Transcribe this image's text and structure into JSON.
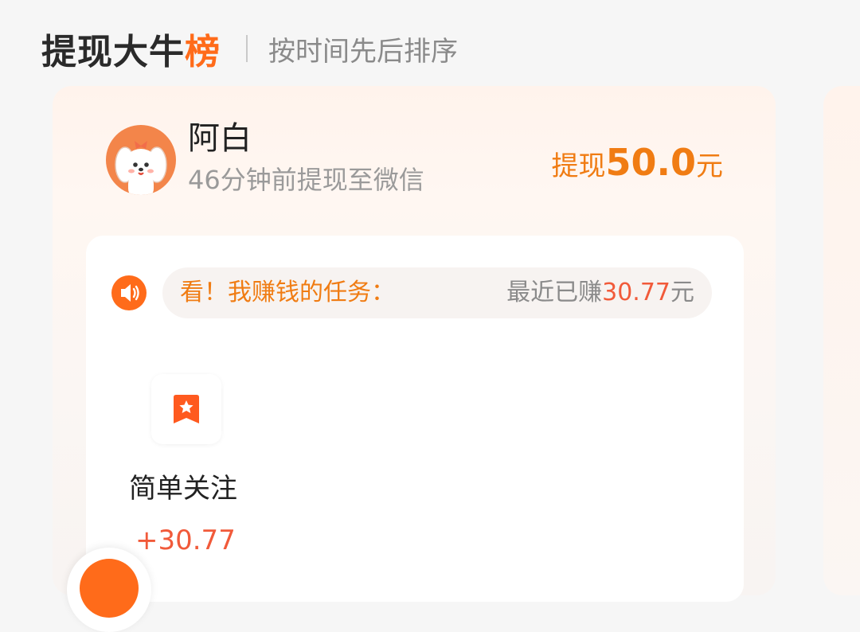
{
  "header": {
    "title_main": "提现大牛",
    "title_accent": "榜",
    "subtitle": "按时间先后排序"
  },
  "record": {
    "user_name": "阿白",
    "meta": "46分钟前提现至微信",
    "withdraw_label": "提现",
    "withdraw_amount": "50.0",
    "withdraw_unit": "元"
  },
  "notice": {
    "label": "看！我赚钱的任务：",
    "recent_prefix": "最近已赚",
    "recent_amount": "30.77",
    "recent_unit": "元"
  },
  "tasks": [
    {
      "name": "简单关注",
      "earning": "+30.77",
      "icon": "bookmark-star-icon"
    }
  ],
  "colors": {
    "accent": "#ff6b1a",
    "withdraw_orange": "#f07c13",
    "earning_red": "#f15a3a"
  }
}
